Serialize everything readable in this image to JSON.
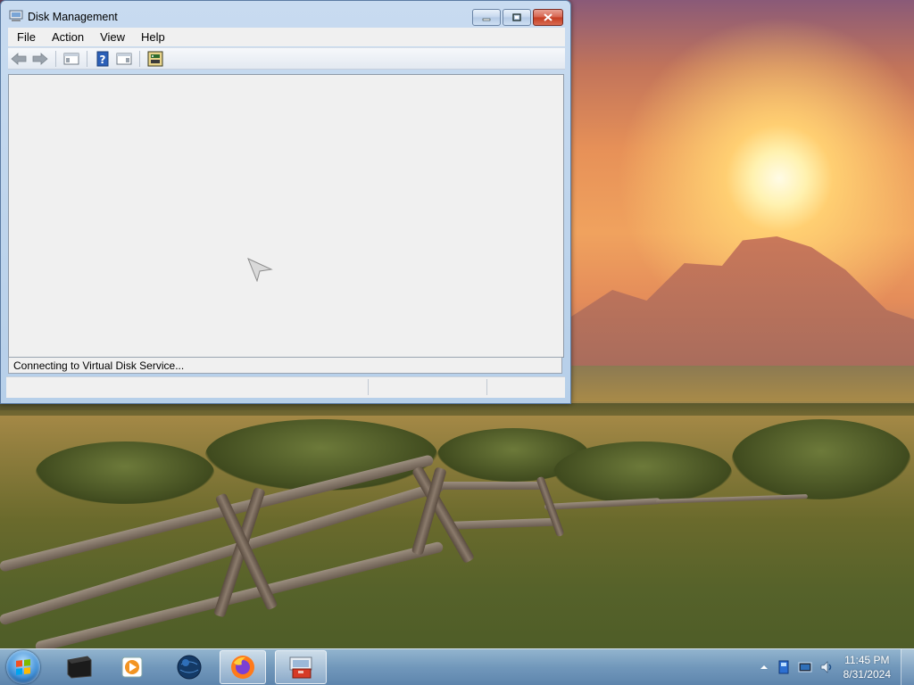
{
  "window": {
    "title": "Disk Management",
    "menus": [
      "File",
      "Action",
      "View",
      "Help"
    ],
    "status_message": "Connecting to Virtual Disk Service..."
  },
  "toolbar": {
    "icons": [
      "back-arrow-icon",
      "forward-arrow-icon",
      "console-tree-icon",
      "help-icon",
      "properties-panel-icon",
      "disk-properties-icon"
    ]
  },
  "taskbar": {
    "apps": [
      "command-terminal-icon",
      "media-player-icon",
      "network-globe-icon",
      "firefox-icon",
      "disk-management-icon"
    ],
    "clock": {
      "time": "11:45 PM",
      "date": "8/31/2024"
    },
    "tray_icons": [
      "show-hidden-icons-icon",
      "action-center-icon",
      "network-icon",
      "volume-icon"
    ]
  },
  "colors": {
    "close_button": "#c43b20",
    "window_frame": "#b6cfe9",
    "taskbar": "#739bc3"
  }
}
